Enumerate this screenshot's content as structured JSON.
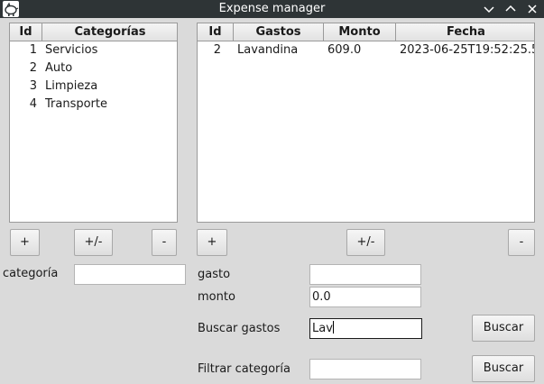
{
  "window": {
    "title": "Expense manager",
    "icons": {
      "app": "piggy-bank-icon",
      "minimize": "chevron-down-icon",
      "maximize": "chevron-up-icon",
      "close": "close-icon"
    }
  },
  "categories_table": {
    "headers": [
      "Id",
      "Categorías"
    ],
    "rows": [
      {
        "id": "1",
        "name": "Servicios"
      },
      {
        "id": "2",
        "name": "Auto"
      },
      {
        "id": "3",
        "name": "Limpieza"
      },
      {
        "id": "4",
        "name": "Transporte"
      }
    ]
  },
  "expenses_table": {
    "headers": [
      "Id",
      "Gastos",
      "Monto",
      "Fecha"
    ],
    "rows": [
      {
        "id": "2",
        "gasto": "Lavandina",
        "monto": "609.0",
        "fecha": "2023-06-25T19:52:25.5"
      }
    ]
  },
  "category_buttons": {
    "add": "+",
    "edit": "+/-",
    "remove": "-"
  },
  "expense_buttons": {
    "add": "+",
    "edit": "+/-",
    "remove": "-"
  },
  "category_form": {
    "label": "categoría",
    "value": ""
  },
  "expense_form": {
    "gasto_label": "gasto",
    "gasto_value": "",
    "monto_label": "monto",
    "monto_value": "0.0",
    "search_label": "Buscar gastos",
    "search_value": "Lav",
    "search_button": "Buscar",
    "filter_label": "Filtrar categoría",
    "filter_value": "",
    "filter_button": "Buscar"
  }
}
